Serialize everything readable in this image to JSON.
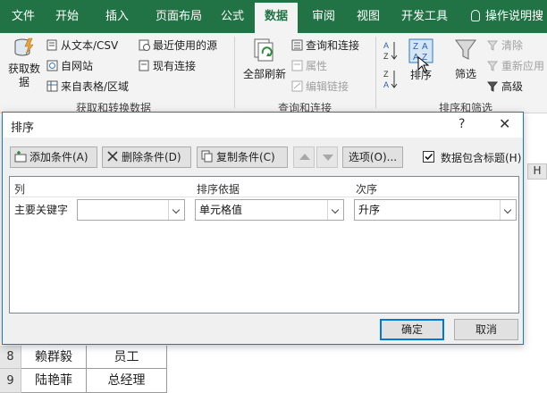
{
  "ribbon_tabs": [
    {
      "label": "文件"
    },
    {
      "label": "开始"
    },
    {
      "label": "插入"
    },
    {
      "label": "页面布局"
    },
    {
      "label": "公式"
    },
    {
      "label": "数据"
    },
    {
      "label": "审阅"
    },
    {
      "label": "视图"
    },
    {
      "label": "开发工具"
    }
  ],
  "tell_me": "操作说明搜",
  "ribbon": {
    "get_data": {
      "line1": "获取数",
      "line2": "据"
    },
    "from_text": "从文本/CSV",
    "from_web": "自网站",
    "from_table": "来自表格/区域",
    "recent_sources": "最近使用的源",
    "existing_connections": "现有连接",
    "group_get_transform": "获取和转换数据",
    "refresh_all": "全部刷新",
    "queries_connections": "查询和连接",
    "properties": "属性",
    "edit_links": "编辑链接",
    "group_queries": "查询和连接",
    "sort_az": "A↓Z",
    "sort_za": "Z↓A",
    "sort": "排序",
    "filter": "筛选",
    "clear": "清除",
    "reapply": "重新应用",
    "advanced": "高级",
    "group_sort_filter": "排序和筛选"
  },
  "sheet": {
    "col_header": "H",
    "rows": [
      {
        "num": "8",
        "name": "赖群毅",
        "title": "员工"
      },
      {
        "num": "9",
        "name": "陆艳菲",
        "title": "总经理"
      }
    ]
  },
  "dialog": {
    "title": "排序",
    "help": "?",
    "close": "✕",
    "add_level": "添加条件(A)",
    "delete_level": "删除条件(D)",
    "copy_level": "复制条件(C)",
    "options": "选项(O)...",
    "header_checkbox": "数据包含标题(H)",
    "columns": {
      "column": "列",
      "sort_on": "排序依据",
      "order": "次序"
    },
    "level": {
      "label": "主要关键字",
      "column_value": "",
      "sort_on_value": "单元格值",
      "order_value": "升序"
    },
    "ok": "确定",
    "cancel": "取消"
  },
  "colors": {
    "accent": "#217346",
    "dialog_border": "#1979ca",
    "ok_border": "#0078d7"
  }
}
